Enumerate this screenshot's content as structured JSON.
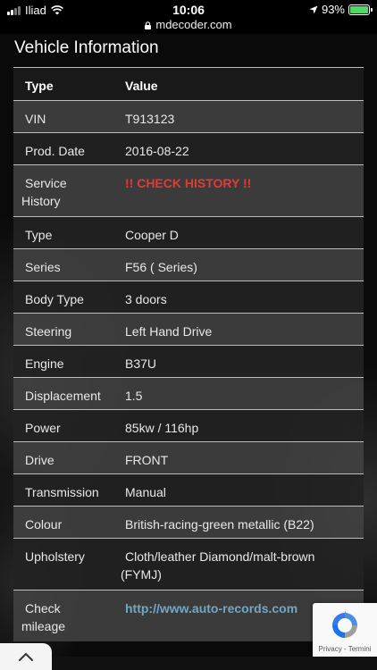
{
  "status_bar": {
    "carrier": "Iliad",
    "time": "10:06",
    "url": "mdecoder.com",
    "battery": "93%"
  },
  "section_title": "Vehicle Information",
  "table": {
    "headers": [
      "Type",
      "Value"
    ],
    "rows": [
      {
        "type": "VIN",
        "value": "T913123"
      },
      {
        "type": "Prod. Date",
        "value": "2016-08-22"
      },
      {
        "type_line1": "Service",
        "type_line2": "History",
        "value": "!! CHECK HISTORY !!"
      },
      {
        "type": "Type",
        "value": "Cooper D"
      },
      {
        "type": "Series",
        "value": "F56 ( Series)"
      },
      {
        "type": "Body Type",
        "value": "3 doors"
      },
      {
        "type": "Steering",
        "value": "Left Hand Drive"
      },
      {
        "type": "Engine",
        "value": "B37U"
      },
      {
        "type": "Displacement",
        "value": "1.5"
      },
      {
        "type": "Power",
        "value": "85kw / 116hp"
      },
      {
        "type": "Drive",
        "value": "FRONT"
      },
      {
        "type": "Transmission",
        "value": "Manual"
      },
      {
        "type": "Colour",
        "value": "British-racing-green metallic (B22)"
      },
      {
        "type": "Upholstery",
        "value_line1": "Cloth/leather Diamond/malt-brown",
        "value_line2": "(FYMJ)"
      },
      {
        "type_line1": "Check",
        "type_line2": "mileage",
        "value": "http://www.auto-records.com"
      }
    ]
  },
  "recaptcha": {
    "text": "Privacy - Termini"
  },
  "colors": {
    "warning": "#e53935",
    "link": "#6fa8c7",
    "battery": "#4cd964"
  }
}
